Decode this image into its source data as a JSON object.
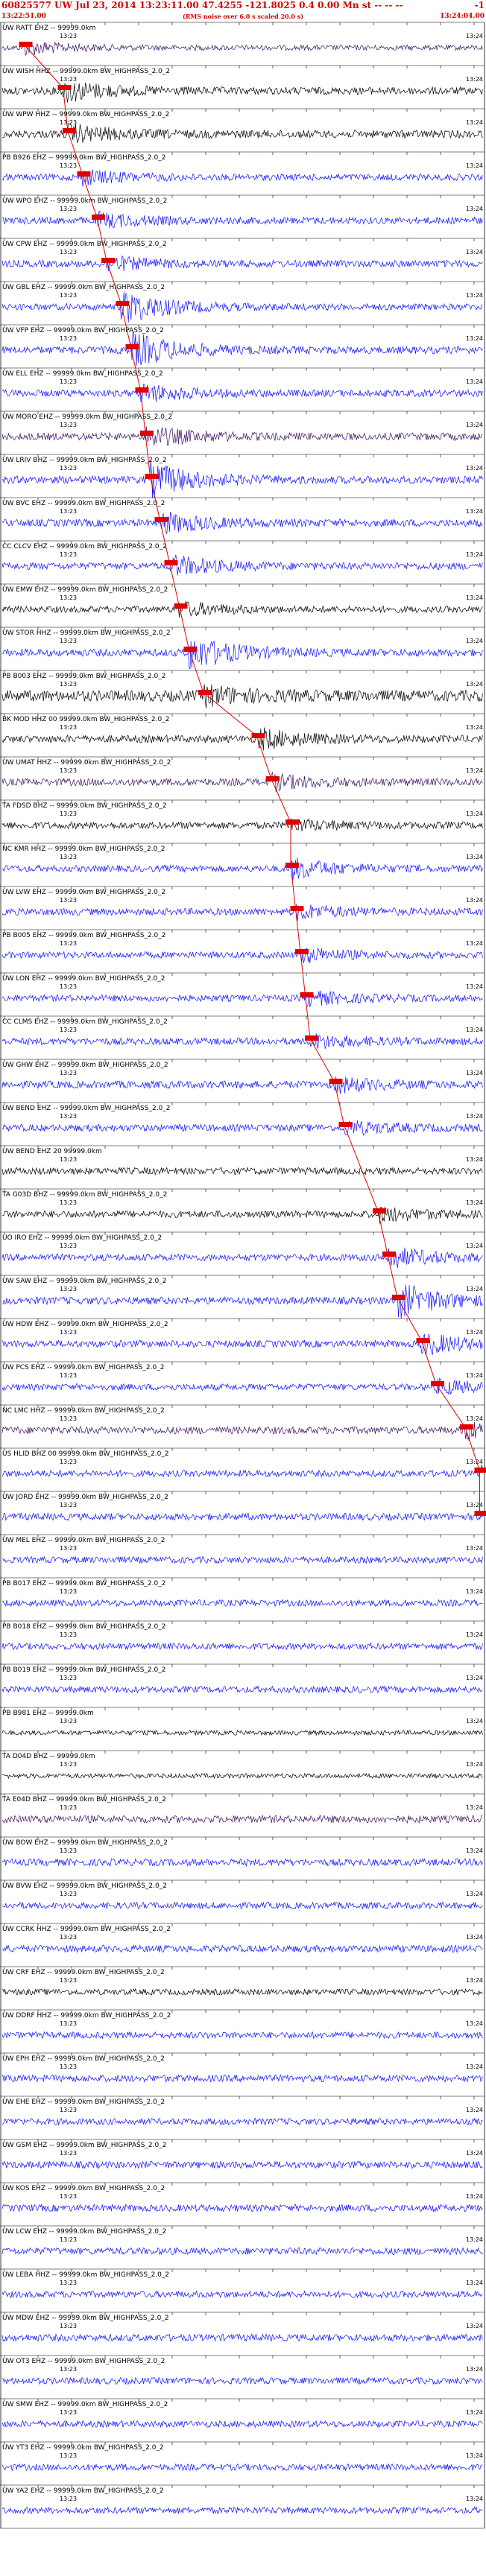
{
  "header": {
    "title": "60825577 UW Jul 23, 2014 13:23:11.00   47.4255 -121.8025  0.4 0.00 Mn st -- -- --",
    "right": "-1",
    "start_time": "13:22:51.00",
    "note": "(RMS noise over 6.0 s scaled 20.0 s)",
    "end_time": "13:24:04.00"
  },
  "colors": {
    "blue": "#1010ff",
    "black": "#000000",
    "purple": "#3a1060",
    "pick": "#e00000",
    "tick": "#000000"
  },
  "chart_data": {
    "type": "line",
    "title": "60825577 UW Jul 23, 2014 13:23:11.00   47.4255 -121.8025  0.4 0.00 Mn st -- -- --",
    "xlabel": "",
    "ylabel": "",
    "time_start": "13:22:51.00",
    "time_end": "13:24:04.00",
    "tick_labels": [
      "13:23",
      "13:24"
    ],
    "traces": [
      {
        "label": "UW RATT EHZ -- 99999.0km",
        "color": "purple",
        "arrival": 0.05,
        "amp": 0.25,
        "burst": 0.4
      },
      {
        "label": "UW WISH HHZ -- 99999.0km BW_HIGHPASS_2.0_2",
        "color": "black",
        "arrival": 0.13,
        "amp": 0.5,
        "burst": 0.6
      },
      {
        "label": "UW WPW HHZ -- 99999.0km BW_HIGHPASS_2.0_2",
        "color": "black",
        "arrival": 0.14,
        "amp": 0.55,
        "burst": 0.5
      },
      {
        "label": "PB B926 EHZ -- 99999.0km BW_HIGHPASS_2.0_2",
        "color": "blue",
        "arrival": 0.17,
        "amp": 0.4,
        "burst": 0.4
      },
      {
        "label": "UW WPO EHZ -- 99999.0km BW_HIGHPASS_2.0_2",
        "color": "blue",
        "arrival": 0.2,
        "amp": 0.45,
        "burst": 0.4
      },
      {
        "label": "UW CPW EHZ -- 99999.0km BW_HIGHPASS_2.0_2",
        "color": "blue",
        "arrival": 0.22,
        "amp": 0.45,
        "burst": 0.4
      },
      {
        "label": "UW GBL EHZ -- 99999.0km BW_HIGHPASS_2.0_2",
        "color": "blue",
        "arrival": 0.25,
        "amp": 0.4,
        "burst": 1.0
      },
      {
        "label": "UW VFP EHZ -- 99999.0km BW_HIGHPASS_2.0_2",
        "color": "blue",
        "arrival": 0.27,
        "amp": 0.5,
        "burst": 1.0
      },
      {
        "label": "UW ELL EHZ -- 99999.0km BW_HIGHPASS_2.0_2",
        "color": "blue",
        "arrival": 0.29,
        "amp": 0.45,
        "burst": 0.5
      },
      {
        "label": "UW MORO EHZ -- 99999.0km BW_HIGHPASS_2.0_2",
        "color": "purple",
        "arrival": 0.3,
        "amp": 0.5,
        "burst": 0.6
      },
      {
        "label": "UW LRIV BHZ -- 99999.0km BW_HIGHPASS_2.0_2",
        "color": "blue",
        "arrival": 0.31,
        "amp": 0.5,
        "burst": 1.0
      },
      {
        "label": "UW BVC EHZ -- 99999.0km BW_HIGHPASS_2.0_2",
        "color": "blue",
        "arrival": 0.33,
        "amp": 0.5,
        "burst": 0.6
      },
      {
        "label": "CC CLCV EHZ -- 99999.0km BW_HIGHPASS_2.0_2",
        "color": "blue",
        "arrival": 0.35,
        "amp": 0.45,
        "burst": 0.6
      },
      {
        "label": "UW EMW EHZ -- 99999.0km BW_HIGHPASS_2.0_2",
        "color": "black",
        "arrival": 0.37,
        "amp": 0.4,
        "burst": 0.4
      },
      {
        "label": "UW STOR HHZ -- 99999.0km BW_HIGHPASS_2.0_2",
        "color": "blue",
        "arrival": 0.39,
        "amp": 0.5,
        "burst": 1.0
      },
      {
        "label": "PB B003 EHZ -- 99999.0km BW_HIGHPASS_2.0_2",
        "color": "black",
        "arrival": 0.42,
        "amp": 0.9,
        "burst": 0.5
      },
      {
        "label": "BK MOD HHZ 00 99999.0km BW_HIGHPASS_2.0_2",
        "color": "black",
        "arrival": 0.53,
        "amp": 0.5,
        "burst": 0.6
      },
      {
        "label": "UW UMAT HHZ -- 99999.0km BW_HIGHPASS_2.0_2",
        "color": "purple",
        "arrival": 0.56,
        "amp": 0.5,
        "burst": 0.4
      },
      {
        "label": "TA FDSD BHZ -- 99999.0km BW_HIGHPASS_2.0_2",
        "color": "black",
        "arrival": 0.6,
        "amp": 0.45,
        "burst": 0.3
      },
      {
        "label": "NC KMR HHZ -- 99999.0km BW_HIGHPASS_2.0_2",
        "color": "blue",
        "arrival": 0.6,
        "amp": 0.4,
        "burst": 0.6
      },
      {
        "label": "UW LVW EHZ -- 99999.0km BW_HIGHPASS_2.0_2",
        "color": "blue",
        "arrival": 0.61,
        "amp": 0.45,
        "burst": 0.4
      },
      {
        "label": "PB B005 EHZ -- 99999.0km BW_HIGHPASS_2.0_2",
        "color": "blue",
        "arrival": 0.62,
        "amp": 0.4,
        "burst": 0.4
      },
      {
        "label": "UW LON EHZ -- 99999.0km BW_HIGHPASS_2.0_2",
        "color": "blue",
        "arrival": 0.63,
        "amp": 0.4,
        "burst": 0.4
      },
      {
        "label": "CC CLMS EHZ -- 99999.0km BW_HIGHPASS_2.0_2",
        "color": "blue",
        "arrival": 0.64,
        "amp": 0.45,
        "burst": 0.4
      },
      {
        "label": "UW GHW EHZ -- 99999.0km BW_HIGHPASS_2.0_2",
        "color": "blue",
        "arrival": 0.69,
        "amp": 0.5,
        "burst": 0.4
      },
      {
        "label": "UW BEND EHZ -- 99999.0km BW_HIGHPASS_2.0_2",
        "color": "blue",
        "arrival": 0.71,
        "amp": 0.45,
        "burst": 0.4
      },
      {
        "label": "UW BEND EHZ 20 99999.0km",
        "color": "black",
        "arrival": -1,
        "amp": 0.45,
        "burst": 0
      },
      {
        "label": "TA G03D BHZ -- 99999.0km BW_HIGHPASS_2.0_2",
        "color": "black",
        "arrival": 0.78,
        "amp": 0.45,
        "burst": 0.4
      },
      {
        "label": "UO IRO EHZ -- 99999.0km BW_HIGHPASS_2.0_2",
        "color": "blue",
        "arrival": 0.8,
        "amp": 0.45,
        "burst": 0.6
      },
      {
        "label": "UW SAW EHZ -- 99999.0km BW_HIGHPASS_2.0_2",
        "color": "blue",
        "arrival": 0.82,
        "amp": 0.5,
        "burst": 1.0
      },
      {
        "label": "UW HDW EHZ -- 99999.0km BW_HIGHPASS_2.0_2",
        "color": "blue",
        "arrival": 0.87,
        "amp": 0.45,
        "burst": 0.6
      },
      {
        "label": "UW PCS EHZ -- 99999.0km BW_HIGHPASS_2.0_2",
        "color": "blue",
        "arrival": 0.9,
        "amp": 0.4,
        "burst": 0.4
      },
      {
        "label": "NC LMC HHZ -- 99999.0km BW_HIGHPASS_2.0_2",
        "color": "purple",
        "arrival": 0.96,
        "amp": 0.5,
        "burst": 0.5
      },
      {
        "label": "US HLID BHZ 00 99999.0km BW_HIGHPASS_2.0_2",
        "color": "blue",
        "arrival": 0.99,
        "amp": 0.4,
        "burst": 0.7
      },
      {
        "label": "UW JORD EHZ -- 99999.0km BW_HIGHPASS_2.0_2",
        "color": "blue",
        "arrival": 0.99,
        "amp": 0.45,
        "burst": 0.5
      },
      {
        "label": "UW MEL EHZ -- 99999.0km BW_HIGHPASS_2.0_2",
        "color": "blue",
        "arrival": -1,
        "amp": 0.4,
        "burst": 0
      },
      {
        "label": "PB B017 EHZ -- 99999.0km BW_HIGHPASS_2.0_2",
        "color": "blue",
        "arrival": -1,
        "amp": 0.4,
        "burst": 0
      },
      {
        "label": "PB B018 EHZ -- 99999.0km BW_HIGHPASS_2.0_2",
        "color": "blue",
        "arrival": -1,
        "amp": 0.4,
        "burst": 0
      },
      {
        "label": "PB B019 EHZ -- 99999.0km BW_HIGHPASS_2.0_2",
        "color": "blue",
        "arrival": -1,
        "amp": 0.4,
        "burst": 0
      },
      {
        "label": "PB B981 EHZ -- 99999.0km",
        "color": "black",
        "arrival": -1,
        "amp": 0.2,
        "burst": 0
      },
      {
        "label": "TA D04D BHZ -- 99999.0km",
        "color": "black",
        "arrival": -1,
        "amp": 0.2,
        "burst": 0
      },
      {
        "label": "TA E04D BHZ -- 99999.0km BW_HIGHPASS_2.0_2",
        "color": "purple",
        "arrival": -1,
        "amp": 0.5,
        "burst": 0
      },
      {
        "label": "UW BOW EHZ -- 99999.0km BW_HIGHPASS_2.0_2",
        "color": "blue",
        "arrival": -1,
        "amp": 0.45,
        "burst": 0
      },
      {
        "label": "UW BVW EHZ -- 99999.0km BW_HIGHPASS_2.0_2",
        "color": "blue",
        "arrival": -1,
        "amp": 0.4,
        "burst": 0
      },
      {
        "label": "UW CCRK HHZ -- 99999.0km BW_HIGHPASS_2.0_2",
        "color": "blue",
        "arrival": -1,
        "amp": 0.45,
        "burst": 0
      },
      {
        "label": "UW CRF EHZ -- 99999.0km BW_HIGHPASS_2.0_2",
        "color": "black",
        "arrival": -1,
        "amp": 0.35,
        "burst": 0
      },
      {
        "label": "UW DDRF HHZ -- 99999.0km BW_HIGHPASS_2.0_2",
        "color": "blue",
        "arrival": -1,
        "amp": 0.4,
        "burst": 0
      },
      {
        "label": "UW EPH EHZ -- 99999.0km BW_HIGHPASS_2.0_2",
        "color": "blue",
        "arrival": -1,
        "amp": 0.45,
        "burst": 0
      },
      {
        "label": "UW EHE EHZ -- 99999.0km BW_HIGHPASS_2.0_2",
        "color": "blue",
        "arrival": -1,
        "amp": 0.4,
        "burst": 0
      },
      {
        "label": "UW GSM EHZ -- 99999.0km BW_HIGHPASS_2.0_2",
        "color": "blue",
        "arrival": -1,
        "amp": 0.45,
        "burst": 0
      },
      {
        "label": "UW KOS EHZ -- 99999.0km BW_HIGHPASS_2.0_2",
        "color": "blue",
        "arrival": -1,
        "amp": 0.45,
        "burst": 0
      },
      {
        "label": "UW LCW EHZ -- 99999.0km BW_HIGHPASS_2.0_2",
        "color": "blue",
        "arrival": -1,
        "amp": 0.45,
        "burst": 0
      },
      {
        "label": "UW LEBA HHZ -- 99999.0km BW_HIGHPASS_2.0_2",
        "color": "blue",
        "arrival": -1,
        "amp": 0.4,
        "burst": 0
      },
      {
        "label": "UW MDW EHZ -- 99999.0km BW_HIGHPASS_2.0_2",
        "color": "blue",
        "arrival": -1,
        "amp": 0.45,
        "burst": 0
      },
      {
        "label": "UW OT3 EHZ -- 99999.0km BW_HIGHPASS_2.0_2",
        "color": "blue",
        "arrival": -1,
        "amp": 0.4,
        "burst": 0
      },
      {
        "label": "UW SMW EHZ -- 99999.0km BW_HIGHPASS_2.0_2",
        "color": "blue",
        "arrival": -1,
        "amp": 0.4,
        "burst": 0
      },
      {
        "label": "UW YT3 EHZ -- 99999.0km BW_HIGHPASS_2.0_2",
        "color": "blue",
        "arrival": -1,
        "amp": 0.4,
        "burst": 0
      },
      {
        "label": "UW YA2 EHZ -- 99999.0km BW_HIGHPASS_2.0_2",
        "color": "blue",
        "arrival": -1,
        "amp": 0.4,
        "burst": 0
      }
    ]
  }
}
